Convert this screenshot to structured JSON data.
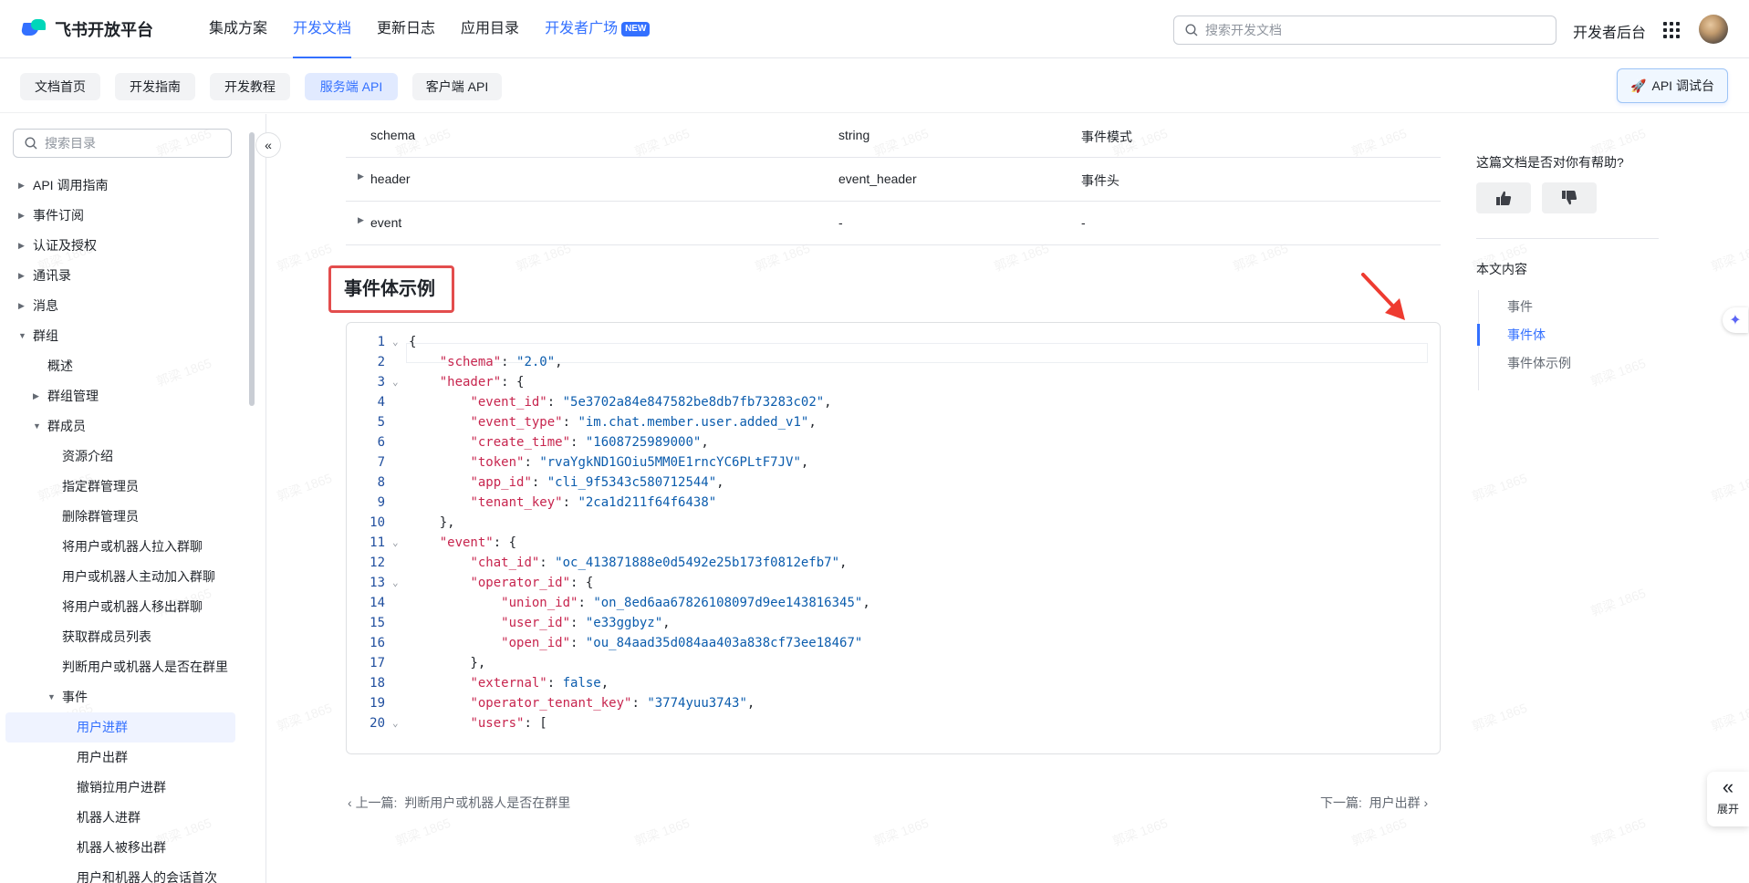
{
  "header": {
    "logo_text": "飞书开放平台",
    "nav": [
      {
        "label": "集成方案",
        "active": false
      },
      {
        "label": "开发文档",
        "active": true
      },
      {
        "label": "更新日志",
        "active": false
      },
      {
        "label": "应用目录",
        "active": false
      },
      {
        "label": "开发者广场",
        "active": false,
        "badge": "NEW"
      }
    ],
    "search_placeholder": "搜索开发文档",
    "dev_console": "开发者后台"
  },
  "subnav": {
    "tabs": [
      {
        "label": "文档首页",
        "active": false
      },
      {
        "label": "开发指南",
        "active": false
      },
      {
        "label": "开发教程",
        "active": false
      },
      {
        "label": "服务端 API",
        "active": true
      },
      {
        "label": "客户端 API",
        "active": false
      }
    ],
    "api_debug": "API 调试台"
  },
  "sidebar": {
    "search_placeholder": "搜索目录",
    "items": [
      {
        "label": "API 调用指南",
        "arrow": "right"
      },
      {
        "label": "事件订阅",
        "arrow": "right"
      },
      {
        "label": "认证及授权",
        "arrow": "right"
      },
      {
        "label": "通讯录",
        "arrow": "right"
      },
      {
        "label": "消息",
        "arrow": "right"
      },
      {
        "label": "群组",
        "arrow": "down"
      },
      {
        "label": "概述",
        "arrow": ""
      },
      {
        "label": "群组管理",
        "arrow": "right"
      },
      {
        "label": "群成员",
        "arrow": "down"
      },
      {
        "label": "资源介绍",
        "arrow": ""
      },
      {
        "label": "指定群管理员",
        "arrow": ""
      },
      {
        "label": "删除群管理员",
        "arrow": ""
      },
      {
        "label": "将用户或机器人拉入群聊",
        "arrow": ""
      },
      {
        "label": "用户或机器人主动加入群聊",
        "arrow": ""
      },
      {
        "label": "将用户或机器人移出群聊",
        "arrow": ""
      },
      {
        "label": "获取群成员列表",
        "arrow": ""
      },
      {
        "label": "判断用户或机器人是否在群里",
        "arrow": ""
      },
      {
        "label": "事件",
        "arrow": "down"
      },
      {
        "label": "用户进群",
        "arrow": "",
        "active": true
      },
      {
        "label": "用户出群",
        "arrow": ""
      },
      {
        "label": "撤销拉用户进群",
        "arrow": ""
      },
      {
        "label": "机器人进群",
        "arrow": ""
      },
      {
        "label": "机器人被移出群",
        "arrow": ""
      },
      {
        "label": "用户和机器人的会话首次",
        "arrow": ""
      }
    ]
  },
  "table": {
    "rows": [
      {
        "name": "schema",
        "type": "string",
        "desc": "事件模式",
        "expandable": false
      },
      {
        "name": "header",
        "type": "event_header",
        "desc": "事件头",
        "expandable": true
      },
      {
        "name": "event",
        "type": "-",
        "desc": "-",
        "expandable": true
      }
    ]
  },
  "section_title": "事件体示例",
  "code": {
    "lines": [
      {
        "n": "1",
        "fold": true,
        "text": "{"
      },
      {
        "n": "2",
        "fold": false,
        "text": "    \"schema\": \"2.0\","
      },
      {
        "n": "3",
        "fold": true,
        "text": "    \"header\": {"
      },
      {
        "n": "4",
        "fold": false,
        "text": "        \"event_id\": \"5e3702a84e847582be8db7fb73283c02\","
      },
      {
        "n": "5",
        "fold": false,
        "text": "        \"event_type\": \"im.chat.member.user.added_v1\","
      },
      {
        "n": "6",
        "fold": false,
        "text": "        \"create_time\": \"1608725989000\","
      },
      {
        "n": "7",
        "fold": false,
        "text": "        \"token\": \"rvaYgkND1GOiu5MM0E1rncYC6PLtF7JV\","
      },
      {
        "n": "8",
        "fold": false,
        "text": "        \"app_id\": \"cli_9f5343c580712544\","
      },
      {
        "n": "9",
        "fold": false,
        "text": "        \"tenant_key\": \"2ca1d211f64f6438\""
      },
      {
        "n": "10",
        "fold": false,
        "text": "    },"
      },
      {
        "n": "11",
        "fold": true,
        "text": "    \"event\": {"
      },
      {
        "n": "12",
        "fold": false,
        "text": "        \"chat_id\": \"oc_413871888e0d5492e25b173f0812efb7\","
      },
      {
        "n": "13",
        "fold": true,
        "text": "        \"operator_id\": {"
      },
      {
        "n": "14",
        "fold": false,
        "text": "            \"union_id\": \"on_8ed6aa67826108097d9ee143816345\","
      },
      {
        "n": "15",
        "fold": false,
        "text": "            \"user_id\": \"e33ggbyz\","
      },
      {
        "n": "16",
        "fold": false,
        "text": "            \"open_id\": \"ou_84aad35d084aa403a838cf73ee18467\""
      },
      {
        "n": "17",
        "fold": false,
        "text": "        },"
      },
      {
        "n": "18",
        "fold": false,
        "text": "        \"external\": false,"
      },
      {
        "n": "19",
        "fold": false,
        "text": "        \"operator_tenant_key\": \"3774yuu3743\","
      },
      {
        "n": "20",
        "fold": true,
        "text": "        \"users\": ["
      }
    ]
  },
  "pager": {
    "prev_label": "上一篇:",
    "prev_title": "判断用户或机器人是否在群里",
    "next_label": "下一篇:",
    "next_title": "用户出群"
  },
  "right_panel": {
    "help_question": "这篇文档是否对你有帮助?",
    "toc_title": "本文内容",
    "toc": [
      {
        "label": "事件",
        "active": false
      },
      {
        "label": "事件体",
        "active": true
      },
      {
        "label": "事件体示例",
        "active": false
      }
    ]
  },
  "expand_label": "展开",
  "watermark": "郭梁 1865"
}
